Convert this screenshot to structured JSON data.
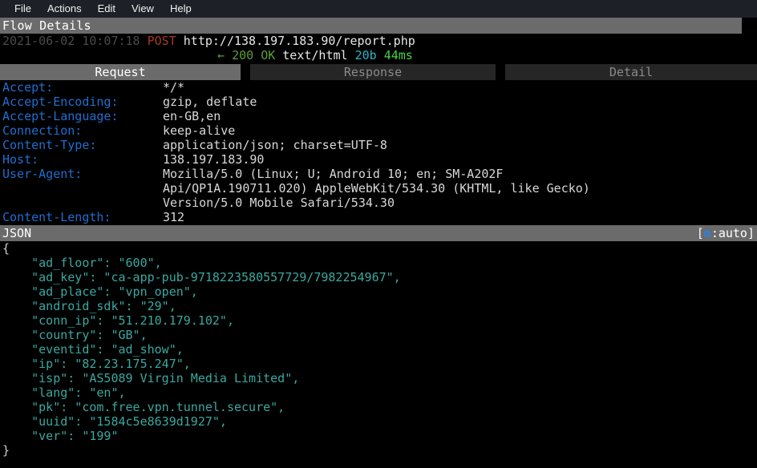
{
  "menubar": {
    "items": [
      {
        "label": "File"
      },
      {
        "label": "Actions"
      },
      {
        "label": "Edit"
      },
      {
        "label": "View"
      },
      {
        "label": "Help"
      }
    ]
  },
  "title": "Flow Details",
  "flow": {
    "timestamp": "2021-06-02 10:07:18",
    "method": "POST",
    "url": "http://138.197.183.90/report.php",
    "response_arrow": "←",
    "status_code": "200",
    "status_text": "OK",
    "content_type": "text/html",
    "size": "20b",
    "duration": "44ms"
  },
  "tabs": [
    {
      "label": "Request",
      "selected": true
    },
    {
      "label": "Response",
      "selected": false
    },
    {
      "label": "Detail",
      "selected": false
    }
  ],
  "request_headers": [
    {
      "name": "Accept:",
      "value": "*/*"
    },
    {
      "name": "Accept-Encoding:",
      "value": "gzip, deflate"
    },
    {
      "name": "Accept-Language:",
      "value": "en-GB,en"
    },
    {
      "name": "Connection:",
      "value": "keep-alive"
    },
    {
      "name": "Content-Type:",
      "value": "application/json; charset=UTF-8"
    },
    {
      "name": "Host:",
      "value": "138.197.183.90"
    },
    {
      "name": "User-Agent:",
      "value": "Mozilla/5.0 (Linux; U; Android 10; en; SM-A202F"
    },
    {
      "name": "",
      "value": "Api/QP1A.190711.020) AppleWebKit/534.30 (KHTML, like Gecko)"
    },
    {
      "name": "",
      "value": "Version/5.0 Mobile Safari/534.30"
    },
    {
      "name": "Content-Length:",
      "value": "312"
    }
  ],
  "body_view": {
    "label": "JSON",
    "hint_prefix": "[",
    "hint_key": "m",
    "hint_suffix": ":auto]"
  },
  "json_body": {
    "open_brace": "{",
    "close_brace": "}",
    "lines": [
      "    \"ad_floor\": \"600\",",
      "    \"ad_key\": \"ca-app-pub-9718223580557729/7982254967\",",
      "    \"ad_place\": \"vpn_open\",",
      "    \"android_sdk\": \"29\",",
      "    \"conn_ip\": \"51.210.179.102\",",
      "    \"country\": \"GB\",",
      "    \"eventid\": \"ad_show\",",
      "    \"ip\": \"82.23.175.247\",",
      "    \"isp\": \"AS5089 Virgin Media Limited\",",
      "    \"lang\": \"en\",",
      "    \"pk\": \"com.free.vpn.tunnel.secure\",",
      "    \"uuid\": \"1584c5e8639d1927\",",
      "    \"ver\": \"199\""
    ]
  },
  "colors": {
    "menubar_bg": "#1d2027",
    "banner_bg": "#6b6b6b",
    "header_name": "#1f6fd0",
    "json_text": "#3aa8a0",
    "method": "#a33b25",
    "status": "#5e9e35",
    "size": "#2fb3c8",
    "duration": "#46d446"
  }
}
